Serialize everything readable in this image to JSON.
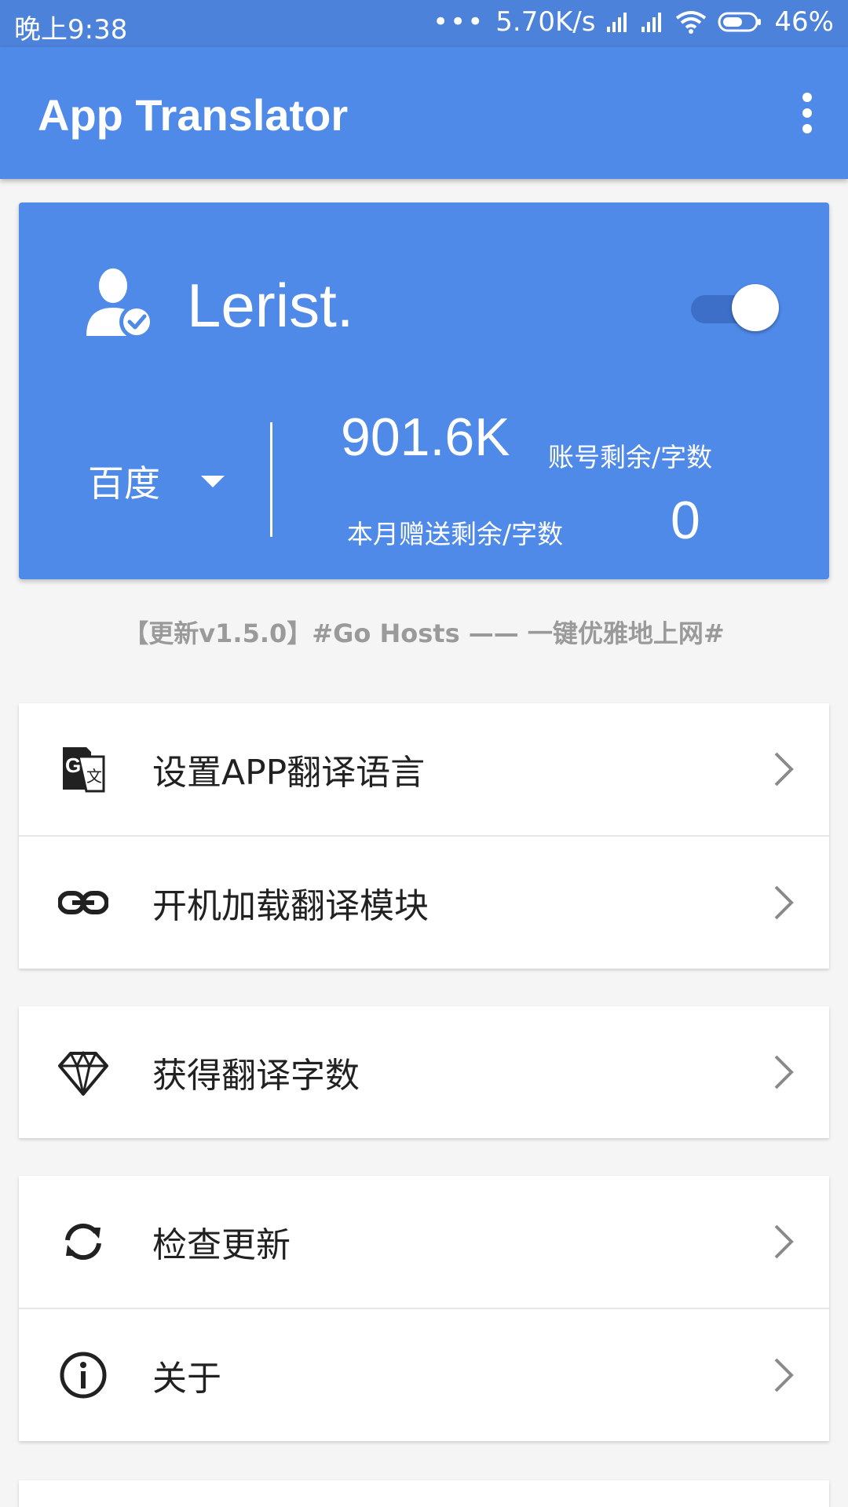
{
  "status_bar": {
    "time": "晚上9:38",
    "dots": "•••",
    "net_speed": "5.70K/s",
    "battery": "46%"
  },
  "app_bar": {
    "title": "App Translator",
    "menu_icon": "more-vert-icon"
  },
  "account": {
    "username": "Lerist.",
    "user_icon": "verified-user-icon",
    "enabled": true,
    "provider": "百度",
    "remaining_value": "901.6K",
    "remaining_label": "账号剩余/字数",
    "gift_label": "本月赠送剩余/字数",
    "gift_value": "0"
  },
  "announcement": "【更新v1.5.0】#Go Hosts —— 一键优雅地上网#",
  "menu": {
    "group1": [
      {
        "label": "设置APP翻译语言",
        "icon": "translate-icon"
      },
      {
        "label": "开机加载翻译模块",
        "icon": "link-icon"
      }
    ],
    "group2": [
      {
        "label": "获得翻译字数",
        "icon": "diamond-icon"
      }
    ],
    "group3": [
      {
        "label": "检查更新",
        "icon": "sync-icon"
      },
      {
        "label": "关于",
        "icon": "info-icon"
      }
    ]
  },
  "colors": {
    "primary": "#508ae9",
    "status_bar": "#4d82db",
    "background": "#f5f5f5",
    "announcement_text": "#9a9a9a"
  }
}
